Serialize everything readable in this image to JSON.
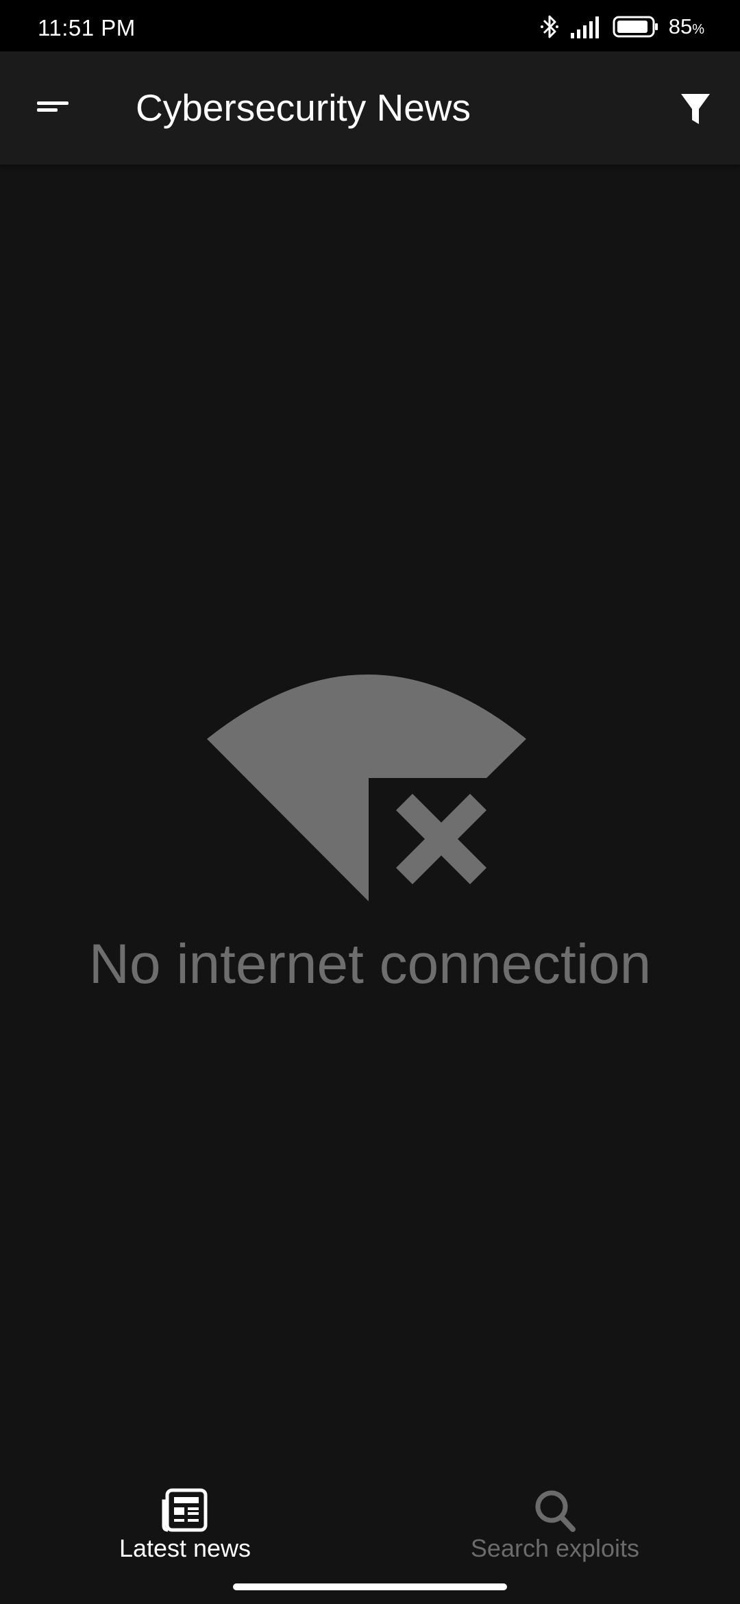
{
  "status_bar": {
    "time": "11:51 PM",
    "battery_value": "85",
    "battery_unit": "%",
    "icons": [
      "bluetooth-icon",
      "signal-icon",
      "battery-icon"
    ]
  },
  "app_bar": {
    "title": "Cybersecurity News",
    "menu_icon": "menu-icon",
    "filter_icon": "filter-icon"
  },
  "empty_state": {
    "icon": "no-wifi-icon",
    "message": "No internet connection"
  },
  "bottom_nav": {
    "items": [
      {
        "label": "Latest news",
        "icon": "newspaper-icon",
        "active": true
      },
      {
        "label": "Search exploits",
        "icon": "search-icon",
        "active": false
      }
    ]
  },
  "colors": {
    "background": "#131313",
    "app_bar": "#1b1b1b",
    "muted": "#6e6e6e",
    "text": "#ffffff"
  }
}
